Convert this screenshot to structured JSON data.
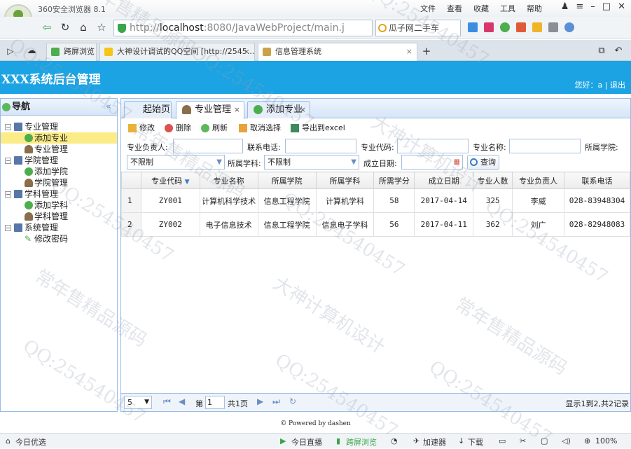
{
  "browser": {
    "app_name": "360安全浏览器 8.1",
    "menus": [
      "文件",
      "查看",
      "收藏",
      "工具",
      "帮助"
    ],
    "url_scheme": "http://",
    "url_host": "localhost",
    "url_rest": ":8080/JavaWebProject/main.j",
    "search_text": "瓜子网二手车",
    "tabs": [
      {
        "label": "跨屏浏览"
      },
      {
        "label": "大神设计调试的QQ空间 [http://2545...]"
      },
      {
        "label": "信息管理系统"
      }
    ]
  },
  "header": {
    "title": "XXX系统后台管理",
    "greeting": "您好：a",
    "logout": "退出"
  },
  "sidebar": {
    "title": "导航",
    "collapse": "«",
    "groups": [
      {
        "label": "专业管理",
        "children": [
          "添加专业",
          "专业管理"
        ]
      },
      {
        "label": "学院管理",
        "children": [
          "添加学院",
          "学院管理"
        ]
      },
      {
        "label": "学科管理",
        "children": [
          "添加学科",
          "学科管理"
        ]
      },
      {
        "label": "系统管理",
        "children": [
          "修改密码"
        ]
      }
    ]
  },
  "main": {
    "tabs": [
      {
        "label": "起始页"
      },
      {
        "label": "专业管理"
      },
      {
        "label": "添加专业"
      }
    ],
    "toolbar": {
      "edit": "修改",
      "delete": "删除",
      "refresh": "刷新",
      "deselect": "取消选择",
      "export": "导出到excel"
    },
    "filters": {
      "leader_label": "专业负责人:",
      "phone_label": "联系电话:",
      "code_label": "专业代码:",
      "name_label": "专业名称:",
      "college_label": "所属学院:",
      "college_value": "不限制",
      "subject_label": "所属学科:",
      "subject_value": "不限制",
      "date_label": "成立日期:",
      "query": "查询"
    },
    "grid": {
      "columns": [
        "专业代码",
        "专业名称",
        "所属学院",
        "所属学科",
        "所需学分",
        "成立日期",
        "专业人数",
        "专业负责人",
        "联系电话"
      ],
      "rows": [
        {
          "num": "1",
          "code": "ZY001",
          "name": "计算机科学技术",
          "college": "信息工程学院",
          "subject": "计算机学科",
          "credits": "58",
          "date": "2017-04-14",
          "students": "325",
          "leader": "李威",
          "phone": "028-83948304"
        },
        {
          "num": "2",
          "code": "ZY002",
          "name": "电子信息技术",
          "college": "信息工程学院",
          "subject": "信息电子学科",
          "credits": "56",
          "date": "2017-04-11",
          "students": "362",
          "leader": "刘广",
          "phone": "028-82948083"
        }
      ]
    },
    "pager": {
      "page_size": "5",
      "page_prefix": "第",
      "page_value": "1",
      "page_suffix": "共1页",
      "info": "显示1到2,共2记录"
    }
  },
  "footer": {
    "text": "© Powered by dashen"
  },
  "statusbar": {
    "left": "今日优选",
    "live": "今日直播",
    "cross": "跨屏浏览",
    "accel": "加速器",
    "download": "下载",
    "zoom": "100%"
  },
  "watermarks": [
    "QQ:254540457",
    "常年售精品源码",
    "大神计算机设计"
  ]
}
